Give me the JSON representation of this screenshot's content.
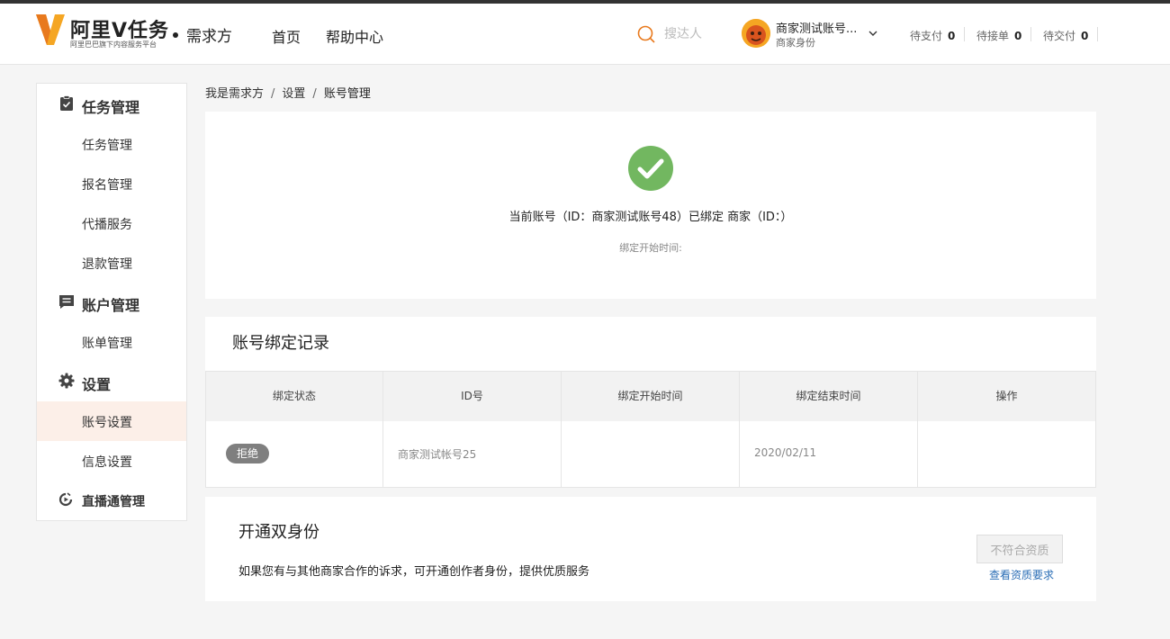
{
  "header": {
    "logo_title": "阿里V任务",
    "logo_subtitle": "阿里巴巴旗下内容服务平台",
    "role": "需求方",
    "nav": [
      "首页",
      "帮助中心"
    ],
    "search_placeholder": "搜达人",
    "user_name": "商家测试账号...",
    "user_role": "商家身份",
    "stats": [
      {
        "label": "待支付",
        "count": "0"
      },
      {
        "label": "待接单",
        "count": "0"
      },
      {
        "label": "待交付",
        "count": "0"
      }
    ]
  },
  "sidebar": {
    "groups": [
      {
        "label": "任务管理",
        "icon": "clipboard-check-icon",
        "items": [
          "任务管理",
          "报名管理",
          "代播服务",
          "退款管理"
        ]
      },
      {
        "label": "账户管理",
        "icon": "message-icon",
        "items": [
          "账单管理"
        ]
      },
      {
        "label": "设置",
        "icon": "gear-icon",
        "items": [
          "账号设置",
          "信息设置"
        ]
      }
    ],
    "link": {
      "label": "直播通管理",
      "icon": "live-tv-icon"
    },
    "active": "账号设置"
  },
  "breadcrumb": [
    "我是需求方",
    "设置",
    "账号管理"
  ],
  "status": {
    "icon": "check-circle-icon",
    "text": "当前账号（ID：商家测试账号48）已绑定 商家（ID：）",
    "time_label": "绑定开始时间:"
  },
  "records": {
    "title": "账号绑定记录",
    "columns": [
      "绑定状态",
      "ID号",
      "绑定开始时间",
      "绑定结束时间",
      "操作"
    ],
    "rows": [
      {
        "status": "拒绝",
        "id": "商家测试帐号25",
        "start": "",
        "end": "2020/02/11",
        "action": ""
      }
    ]
  },
  "dual": {
    "title": "开通双身份",
    "desc": "如果您有与其他商家合作的诉求，可开通创作者身份，提供优质服务",
    "button": "不符合资质",
    "link": "查看资质要求"
  },
  "colors": {
    "accent": "#f5a623",
    "success": "#72b760",
    "link": "#2a6db5",
    "active_bg": "#fcefe8"
  }
}
